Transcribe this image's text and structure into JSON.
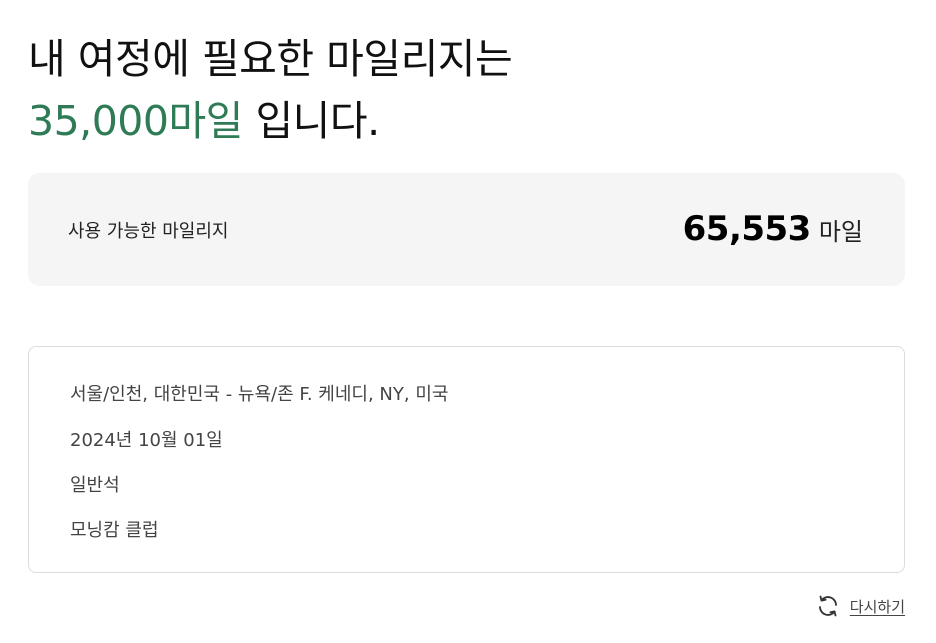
{
  "headline": {
    "line1": "내 여정에 필요한 마일리지는",
    "required_miles": "35,000마일",
    "line2_suffix": " 입니다."
  },
  "available": {
    "label": "사용 가능한 마일리지",
    "amount": "65,553",
    "unit": "마일"
  },
  "trip": {
    "route": "서울/인천, 대한민국 - 뉴욕/존 F. 케네디, NY, 미국",
    "date": "2024년 10월 01일",
    "cabin": "일반석",
    "membership": "모닝캄 클럽"
  },
  "actions": {
    "reset_label": "다시하기",
    "reset_icon": "refresh-icon"
  },
  "colors": {
    "accent": "#2e7b56",
    "card_bg": "#f5f5f5",
    "border": "#dcdcdc"
  }
}
